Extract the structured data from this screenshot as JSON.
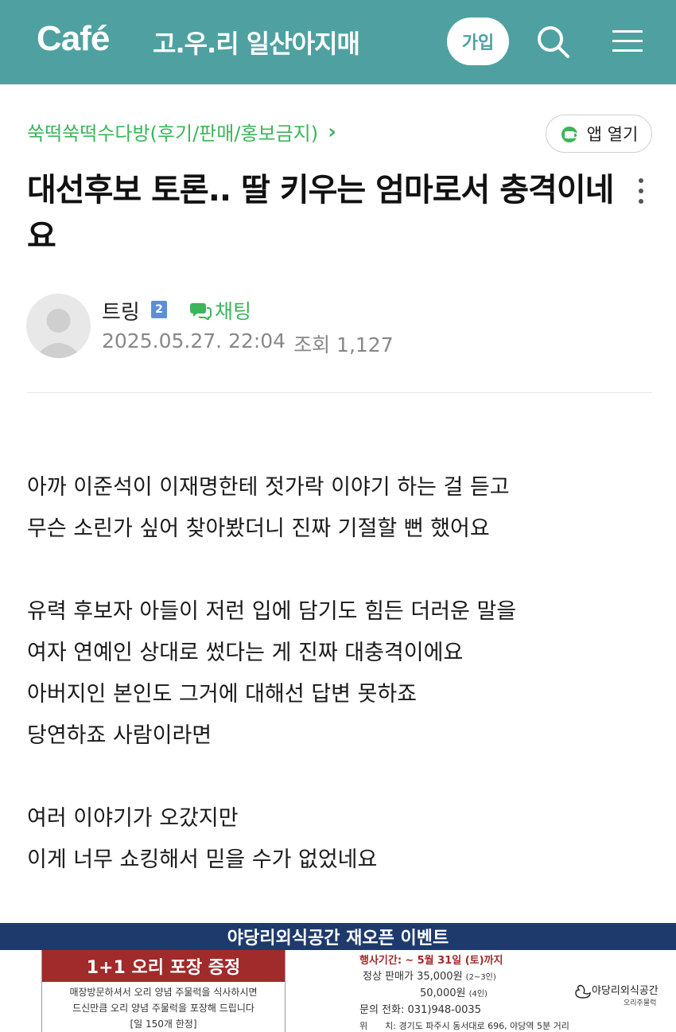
{
  "header": {
    "logo": "Café",
    "cafe_name": "고.우.리 일산아지매",
    "join_label": "가입"
  },
  "board": {
    "name": "쑥떡쑥떡수다방(후기/판매/홍보금지)",
    "chevron": "›",
    "app_open_label": "앱 열기"
  },
  "post": {
    "title": "대선후보 토론.. 딸 키우는 엄마로서 충격이네요",
    "author": "트링",
    "level": "2",
    "chat_label": "채팅",
    "date": "2025.05.27. 22:04",
    "views": "조회 1,127",
    "body_lines": [
      "아까 이준석이 이재명한테 젓가락 이야기 하는 걸 듣고",
      "무슨 소린가 싶어 찾아봤더니 진짜 기절할 뻔 했어요",
      "",
      "유력 후보자 아들이 저런 입에 담기도 힘든 더러운 말을",
      "여자 연예인 상대로 썼다는 게 진짜 대충격이에요",
      "아버지인 본인도 그거에 대해선 답변 못하죠",
      "당연하죠 사람이라면",
      "",
      "여러 이야기가 오갔지만",
      "이게 너무 쇼킹해서 믿을 수가 없었네요"
    ]
  },
  "ad": {
    "headline": "야당리외식공간 재오픈 이벤트",
    "promo": "1+1 오리 포장 증정",
    "promo_line1": "매장방문하셔서 오리 양념 주물럭을 식사하시면",
    "promo_line2": "드신만큼 오리 양념 주물럭을 포장해 드립니다",
    "promo_line3": "[일 150개 한정]",
    "period_label": "행사기간:",
    "period_value": "~ 5월 31일 (토)까지",
    "price_label": "정상 판매가",
    "price1": "35,000원",
    "price1_note": "(2~3인)",
    "price2": "50,000원",
    "price2_note": "(4인)",
    "phone_label": "문의 전화:",
    "phone_value": "031)948-0035",
    "address_label": "위　　치:",
    "address_value": "경기도 파주시 동서대로 696, 야당역 5분 거리",
    "logo_text": "야당리외식공간",
    "logo_sub": "오리주물럭"
  },
  "colors": {
    "header_bg": "#4fa1a1",
    "accent_green": "#3cb55a",
    "ad_navy": "#1e3a6d",
    "ad_red": "#a12a2a"
  }
}
